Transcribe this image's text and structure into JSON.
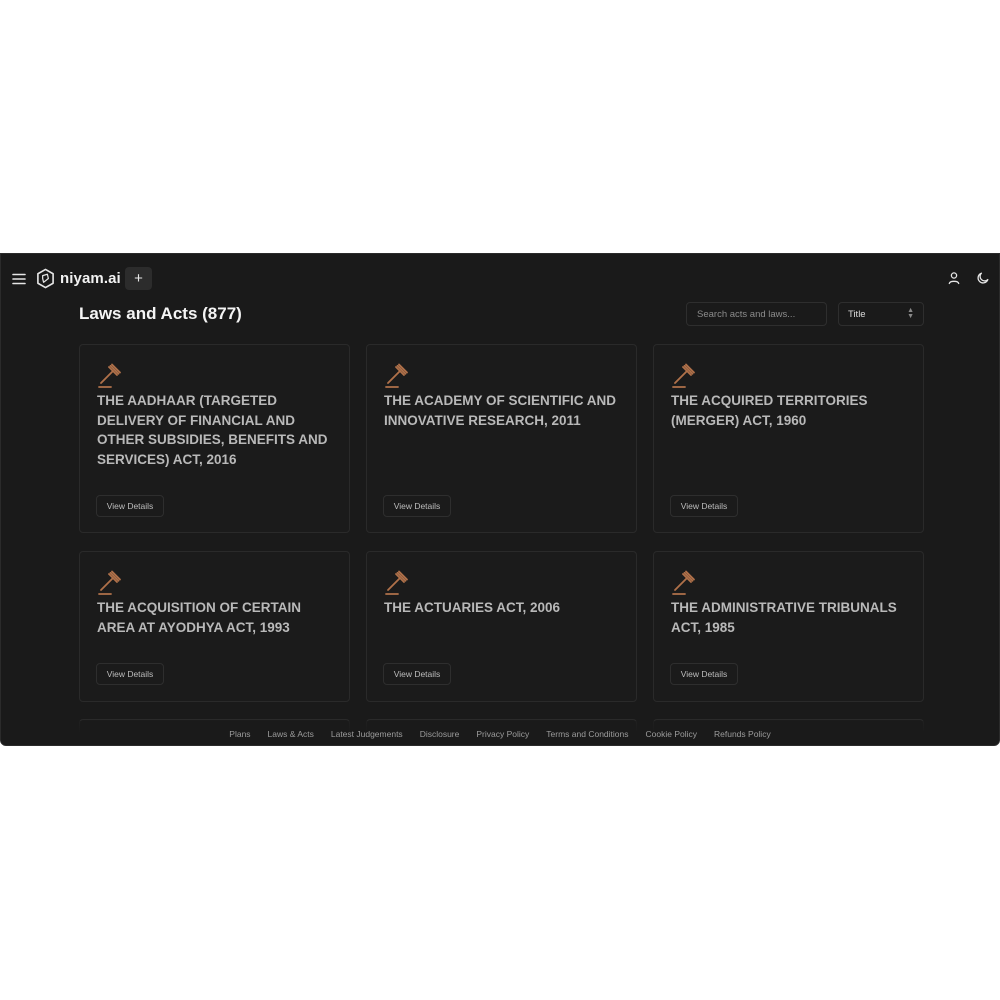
{
  "app": {
    "brand": "niyam.ai",
    "new_label": "+"
  },
  "page": {
    "title": "Laws and Acts (877)",
    "search_placeholder": "Search acts and laws...",
    "sort_value": "Title"
  },
  "acts": [
    {
      "title": "THE AADHAAR (TARGETED DELIVERY OF FINANCIAL AND OTHER SUBSIDIES, BENEFITS AND SERVICES) ACT, 2016",
      "button": "View Details"
    },
    {
      "title": "THE ACADEMY OF SCIENTIFIC AND INNOVATIVE RESEARCH, 2011",
      "button": "View Details"
    },
    {
      "title": "THE ACQUIRED TERRITORIES (MERGER) ACT, 1960",
      "button": "View Details"
    },
    {
      "title": "THE ACQUISITION OF CERTAIN AREA AT AYODHYA ACT, 1993",
      "button": "View Details"
    },
    {
      "title": "THE ACTUARIES ACT, 2006",
      "button": "View Details"
    },
    {
      "title": "THE ADMINISTRATIVE TRIBUNALS ACT, 1985",
      "button": "View Details"
    }
  ],
  "footer": {
    "links": [
      "Plans",
      "Laws & Acts",
      "Latest Judgements",
      "Disclosure",
      "Privacy Policy",
      "Terms and Conditions",
      "Cookie Policy",
      "Refunds Policy"
    ]
  },
  "colors": {
    "background": "#1a1a1a",
    "accent_icon": "#b0714a"
  },
  "icons": {
    "menu": "hamburger-icon",
    "logo": "hexagon-logo-icon",
    "card": "gavel-icon",
    "user": "user-icon",
    "theme": "moon-icon",
    "sort": "chevron-up-down-icon"
  }
}
